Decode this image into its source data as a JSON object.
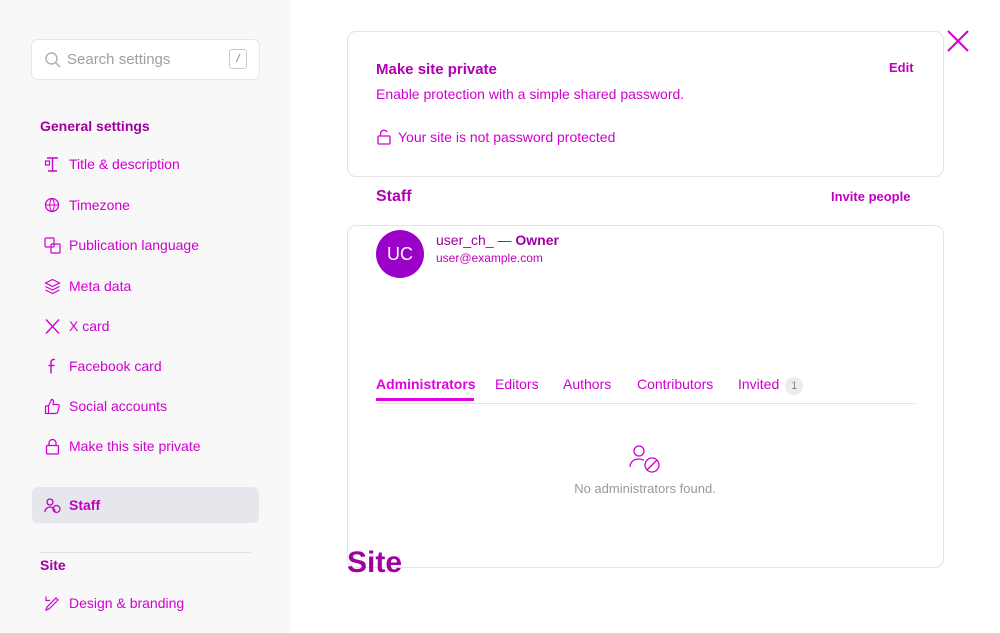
{
  "search": {
    "placeholder": "Search settings",
    "shortcut": "/"
  },
  "sidebar": {
    "general_title": "General settings",
    "items": [
      {
        "label": "Title & description",
        "icon": "title-icon"
      },
      {
        "label": "Timezone",
        "icon": "timezone-icon"
      },
      {
        "label": "Publication language",
        "icon": "language-icon"
      },
      {
        "label": "Meta data",
        "icon": "meta-data-icon"
      },
      {
        "label": "X card",
        "icon": "x-icon"
      },
      {
        "label": "Facebook card",
        "icon": "facebook-icon"
      },
      {
        "label": "Social accounts",
        "icon": "thumbs-up-icon"
      },
      {
        "label": "Make this site private",
        "icon": "lock-icon"
      },
      {
        "label": "Staff",
        "icon": "staff-icon",
        "active": true
      }
    ],
    "site_title": "Site",
    "site_items": [
      {
        "label": "Design & branding",
        "icon": "design-icon"
      }
    ]
  },
  "private": {
    "title": "Make site private",
    "edit": "Edit",
    "description": "Enable protection with a simple shared password.",
    "status": "Your site is not password protected"
  },
  "staff": {
    "title": "Staff",
    "invite": "Invite people",
    "owner": {
      "initials": "UC",
      "name": "user_ch_",
      "separator": " — ",
      "role": "Owner",
      "email": "user@example.com"
    },
    "tabs": [
      {
        "label": "Administrators",
        "active": true
      },
      {
        "label": "Editors"
      },
      {
        "label": "Authors"
      },
      {
        "label": "Contributors"
      },
      {
        "label": "Invited",
        "count": "1"
      }
    ],
    "empty": "No administrators found."
  },
  "site_heading": "Site",
  "colors": {
    "accent": "#e000e0",
    "heading": "#a000a0",
    "avatar": "#9a00c8"
  }
}
